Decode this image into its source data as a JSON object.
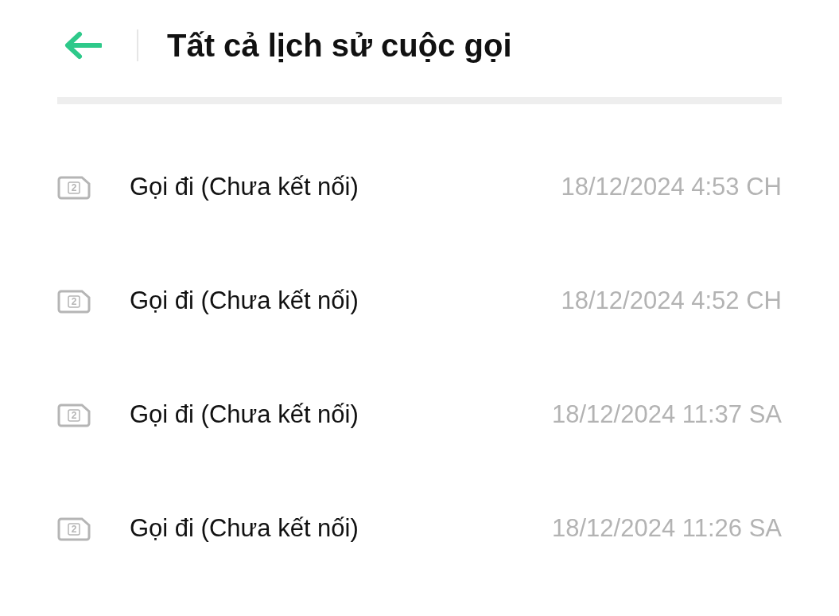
{
  "header": {
    "title": "Tất cả lịch sử cuộc gọi"
  },
  "calls": [
    {
      "sim": "2",
      "label": "Gọi đi (Chưa kết nối)",
      "time": "18/12/2024 4:53 CH"
    },
    {
      "sim": "2",
      "label": "Gọi đi (Chưa kết nối)",
      "time": "18/12/2024 4:52 CH"
    },
    {
      "sim": "2",
      "label": "Gọi đi (Chưa kết nối)",
      "time": "18/12/2024 11:37 SA"
    },
    {
      "sim": "2",
      "label": "Gọi đi (Chưa kết nối)",
      "time": "18/12/2024 11:26 SA"
    }
  ]
}
